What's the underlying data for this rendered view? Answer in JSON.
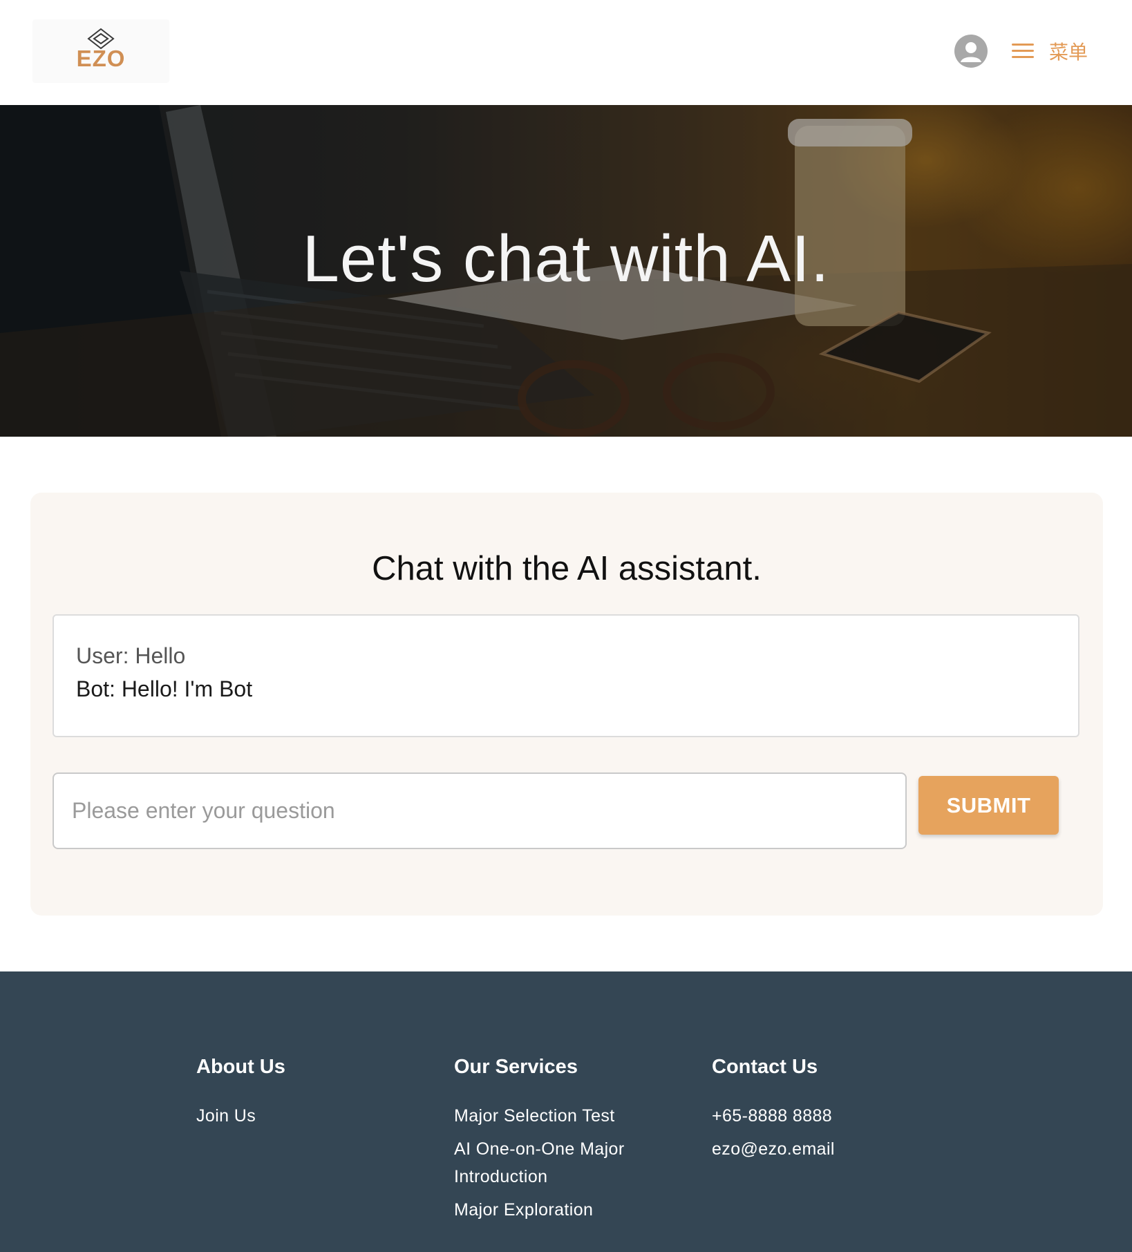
{
  "header": {
    "logo_text": "EZO",
    "menu_label": "菜单",
    "icons": {
      "logo": "diamond-logo-icon",
      "avatar": "user-avatar-icon",
      "menu": "hamburger-menu-icon"
    },
    "colors": {
      "accent": "#e39a55",
      "logo": "#d08f54"
    }
  },
  "hero": {
    "title": "Let's chat with AI."
  },
  "chat": {
    "title": "Chat with the AI assistant.",
    "messages": [
      {
        "text": "User: Hello",
        "role": "user"
      },
      {
        "text": "Bot: Hello! I'm Bot",
        "role": "bot"
      }
    ],
    "input": {
      "placeholder": "Please enter your question",
      "value": ""
    },
    "submit_label": "SUBMIT",
    "colors": {
      "panel_bg": "#faf6f2",
      "button": "#e6a35d"
    }
  },
  "footer": {
    "background": "#344654",
    "columns": [
      {
        "heading": "About Us",
        "links": [
          "Join Us"
        ]
      },
      {
        "heading": "Our Services",
        "links": [
          "Major Selection Test",
          "AI One-on-One Major Introduction",
          "Major Exploration"
        ]
      },
      {
        "heading": "Contact Us",
        "links": [
          "+65-8888 8888",
          "ezo@ezo.email"
        ]
      }
    ]
  }
}
